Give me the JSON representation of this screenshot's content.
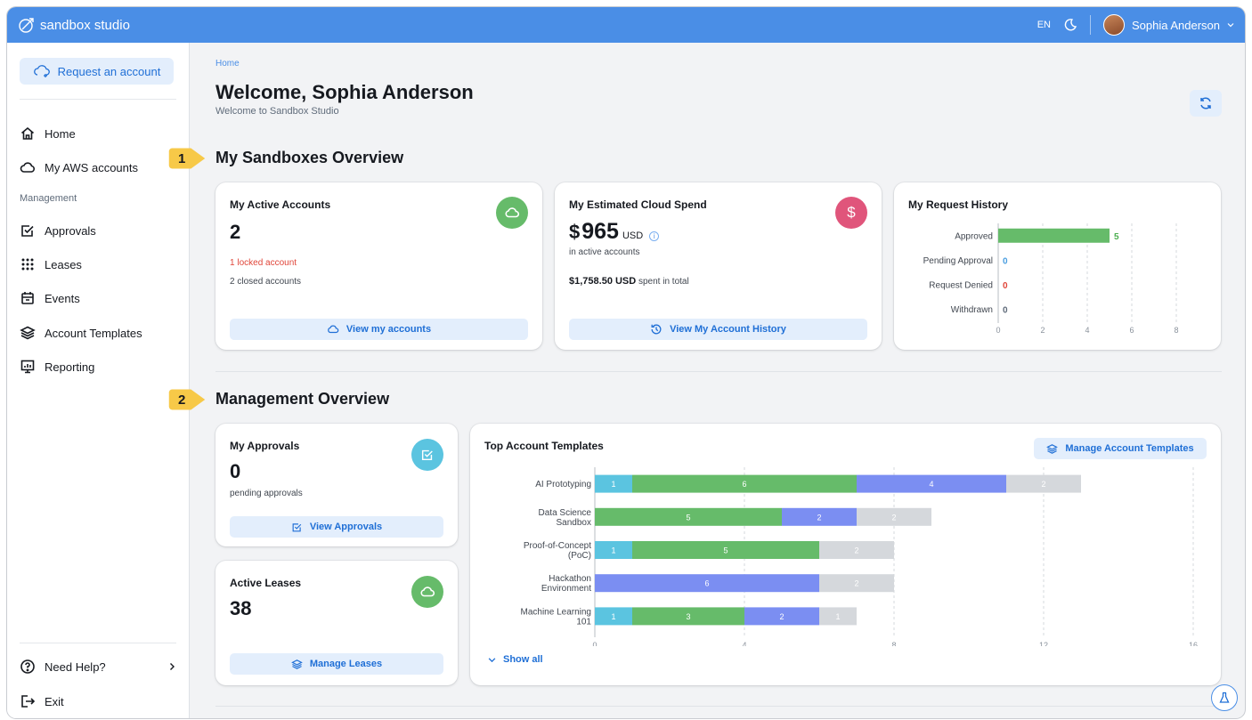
{
  "app": {
    "title": "sandbox studio"
  },
  "topbar": {
    "language": "EN",
    "user_name": "Sophia Anderson"
  },
  "sidebar": {
    "request_button": "Request an account",
    "items": [
      {
        "label": "Home"
      },
      {
        "label": "My AWS accounts"
      }
    ],
    "section_label": "Management",
    "mgmt_items": [
      {
        "label": "Approvals"
      },
      {
        "label": "Leases"
      },
      {
        "label": "Events"
      },
      {
        "label": "Account Templates"
      },
      {
        "label": "Reporting"
      }
    ],
    "help": "Need Help?",
    "exit": "Exit"
  },
  "header": {
    "breadcrumb": "Home",
    "title": "Welcome, Sophia Anderson",
    "subtitle": "Welcome to Sandbox Studio"
  },
  "callouts": [
    "1",
    "2"
  ],
  "sandboxes": {
    "title": "My Sandboxes Overview",
    "active": {
      "title": "My Active Accounts",
      "count": "2",
      "locked_num": "1",
      "locked_text": "locked account",
      "closed_num": "2",
      "closed_text": "closed accounts",
      "button": "View my accounts"
    },
    "spend": {
      "title": "My Estimated Cloud Spend",
      "currency_symbol": "$",
      "amount": "965",
      "unit": "USD",
      "note": "in active accounts",
      "total_amount": "$1,758.50 USD",
      "total_text": "spent in total",
      "button": "View My Account History"
    },
    "history": {
      "title": "My Request History"
    }
  },
  "management": {
    "title": "Management Overview",
    "approvals": {
      "title": "My Approvals",
      "count": "0",
      "note": "pending approvals",
      "button": "View Approvals"
    },
    "leases": {
      "title": "Active Leases",
      "count": "38",
      "button": "Manage Leases"
    },
    "templates": {
      "title": "Top Account Templates",
      "button": "Manage Account Templates",
      "show_all": "Show all"
    }
  },
  "fab": {
    "icon": "flask-icon"
  },
  "colors": {
    "topbar": "#4a8ee6",
    "green": "#66bb6a",
    "blue": "#7b8ef2",
    "cyan": "#5bc4e0",
    "gray": "#d5d8dc",
    "pink": "#e0557b",
    "red": "#e0463a"
  },
  "chart_data": [
    {
      "type": "bar",
      "orientation": "horizontal",
      "categories": [
        "Approved",
        "Pending Approval",
        "Request Denied",
        "Withdrawn"
      ],
      "values": [
        5,
        0,
        0,
        0
      ],
      "value_colors": [
        "#4caf50",
        "#4a9ee0",
        "#e0463a",
        "#5f6b7a"
      ],
      "xlim": [
        0,
        8
      ],
      "x_ticks": [
        0,
        2,
        4,
        6,
        8
      ],
      "grid": true
    },
    {
      "type": "bar",
      "orientation": "horizontal",
      "stacked": true,
      "categories": [
        [
          "AI Prototyping"
        ],
        [
          "Data Science",
          "Sandbox"
        ],
        [
          "Proof-of-Concept",
          "(PoC)"
        ],
        [
          "Hackathon",
          "Environment"
        ],
        [
          "Machine Learning",
          "101"
        ]
      ],
      "series": [
        {
          "color": "#5bc4e0",
          "values": [
            1,
            0,
            1,
            0,
            1
          ]
        },
        {
          "color": "#66bb6a",
          "values": [
            6,
            5,
            5,
            0,
            3
          ]
        },
        {
          "color": "#7b8ef2",
          "values": [
            4,
            2,
            0,
            6,
            2
          ]
        },
        {
          "color": "#d5d8dc",
          "values": [
            2,
            2,
            2,
            2,
            1
          ]
        }
      ],
      "xlim": [
        0,
        16
      ],
      "x_ticks": [
        0,
        4,
        8,
        12,
        16
      ],
      "grid": true
    }
  ]
}
